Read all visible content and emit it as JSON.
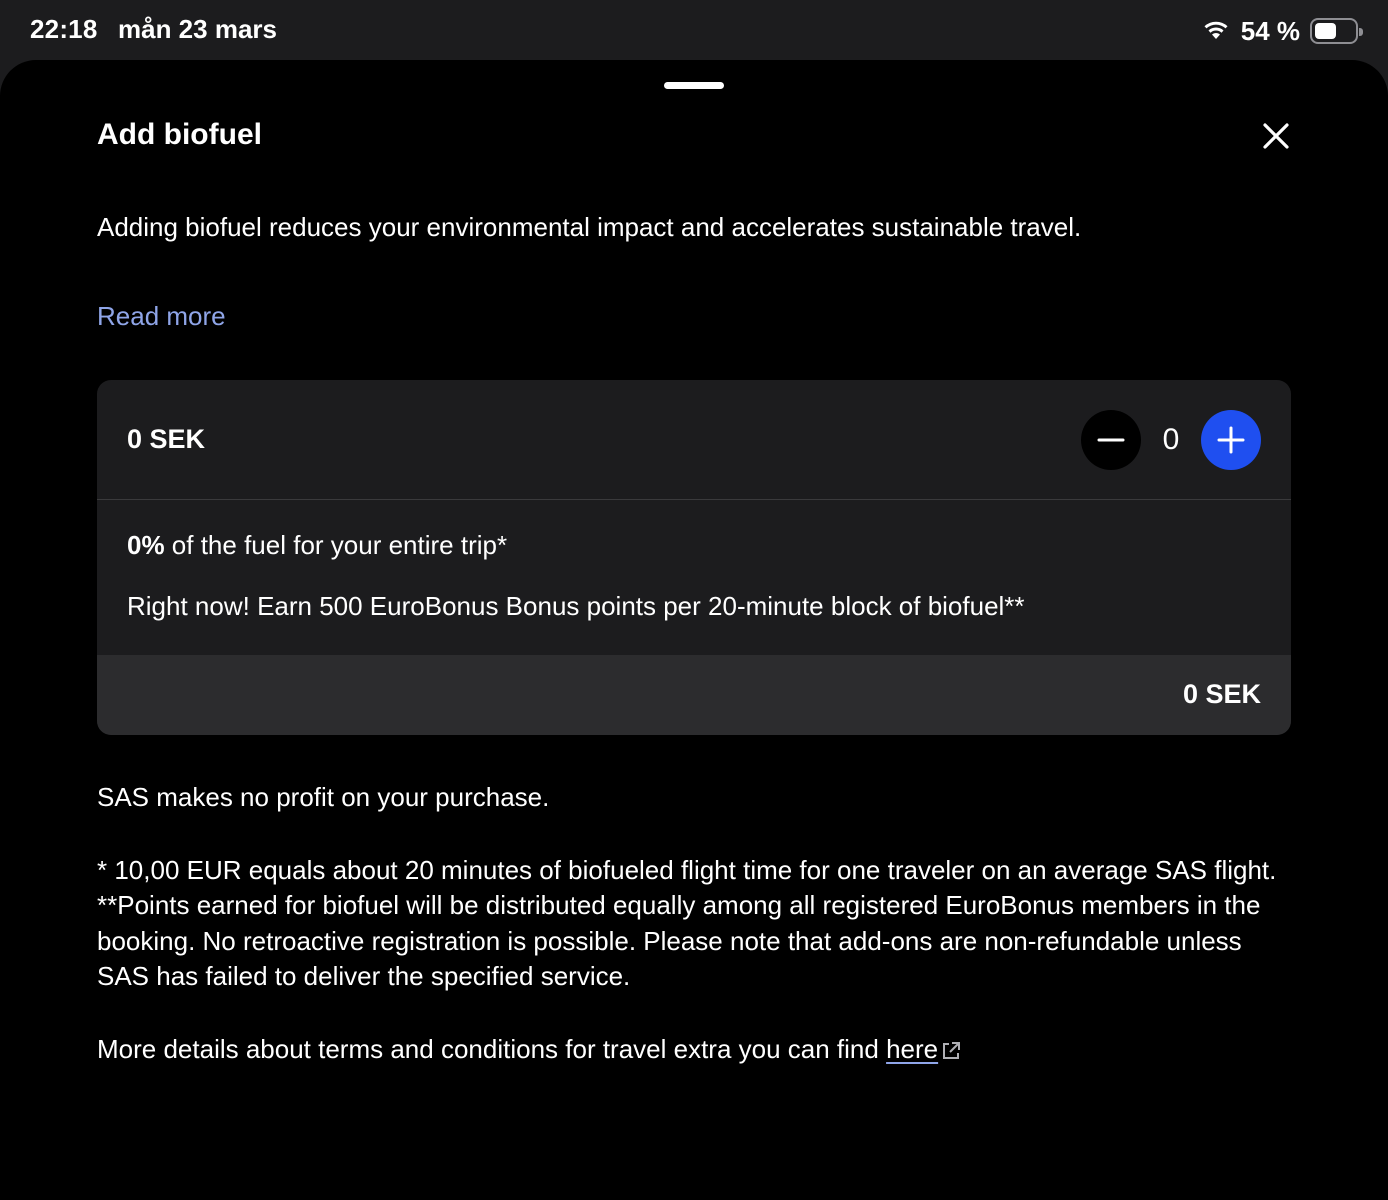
{
  "status_bar": {
    "time": "22:18",
    "date": "mån 23 mars",
    "battery_percent": "54 %",
    "battery_level": 0.54
  },
  "sheet": {
    "title": "Add biofuel",
    "close_icon": "close-icon",
    "intro": "Adding biofuel reduces your environmental impact and accelerates sustainable travel.",
    "read_more": "Read more"
  },
  "card": {
    "price": "0 SEK",
    "quantity": "0",
    "fuel_percent": "0%",
    "fuel_text": " of the fuel for your entire trip*",
    "bonus_text": "Right now! Earn 500 EuroBonus Bonus points per 20-minute block of biofuel**",
    "total": "0 SEK"
  },
  "footer": {
    "no_profit": "SAS makes no profit on your purchase.",
    "note1": "* 10,00 EUR equals about 20 minutes of biofueled flight time for one traveler on an average SAS flight.",
    "note2": "**Points earned for biofuel will be distributed equally among all registered EuroBonus members in the booking. No retroactive registration is possible. Please note that add-ons are non-refundable unless SAS has failed to deliver the specified service.",
    "terms_prefix": "More details about terms and conditions for travel extra you can find ",
    "terms_link": "here"
  },
  "colors": {
    "accent_blue": "#1f4ff0",
    "link_blue": "#8fa5e8",
    "sheet_bg": "#000000",
    "card_bg": "#1c1c1e"
  }
}
